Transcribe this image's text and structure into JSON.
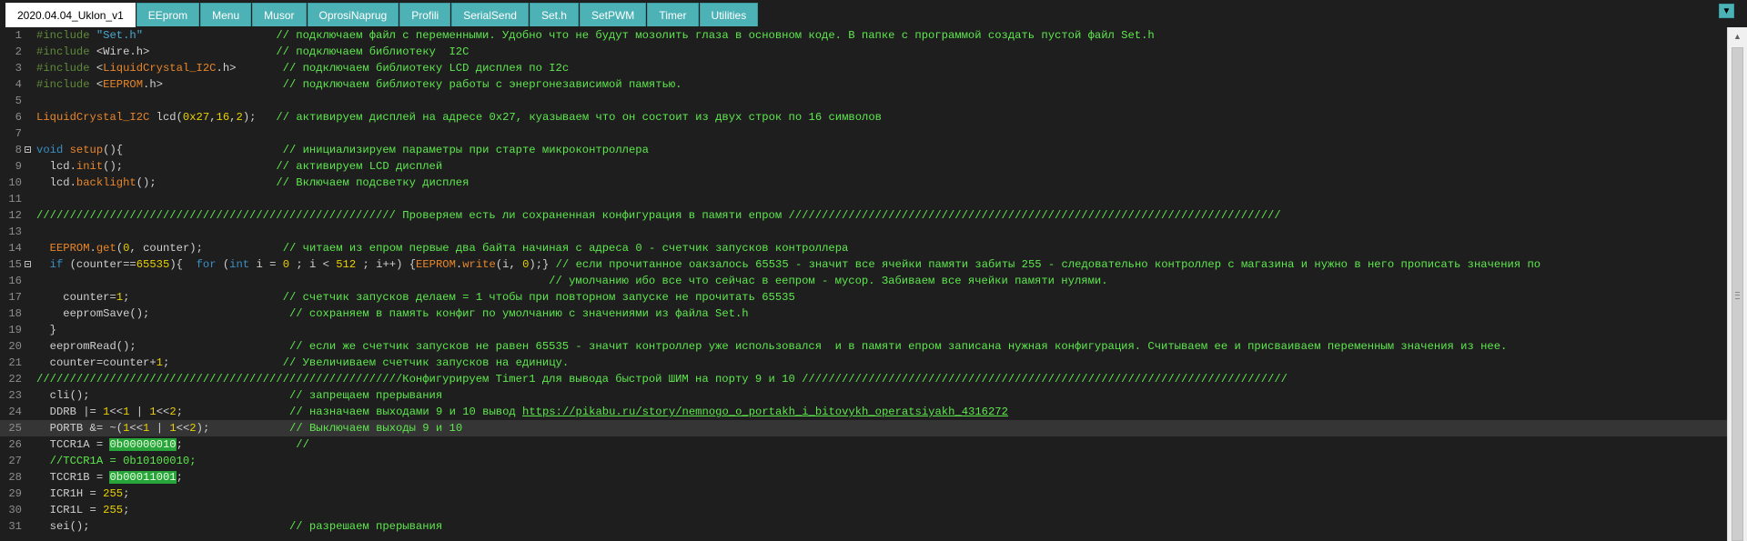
{
  "tabs": [
    {
      "label": "2020.04.04_Uklon_v1",
      "active": true
    },
    {
      "label": "EEprom"
    },
    {
      "label": "Menu"
    },
    {
      "label": "Musor"
    },
    {
      "label": "OprosiNaprug"
    },
    {
      "label": "Profili"
    },
    {
      "label": "SerialSend"
    },
    {
      "label": "Set.h"
    },
    {
      "label": "SetPWM"
    },
    {
      "label": "Timer"
    },
    {
      "label": "Utilities"
    }
  ],
  "tab_menu_icon": "▼",
  "scrollbar_up_icon": "▲",
  "current_line": 25,
  "colors": {
    "tab_bg": "#4db2b6",
    "editor_bg": "#1e1e1e",
    "comment": "#5ee84e",
    "keyword": "#3a8fc4",
    "number": "#e8d000",
    "class": "#e8862a"
  },
  "lines": [
    {
      "n": "1",
      "tokens": [
        {
          "t": "#include ",
          "c": "prep"
        },
        {
          "t": "\"Set.h\"",
          "c": "str"
        },
        {
          "t": "                    "
        },
        {
          "t": "// подключаем файл с переменными. Удобно что не будут мозолить глаза в основном коде. В папке с программой создать пустой файл Set.h",
          "c": "cmt"
        }
      ]
    },
    {
      "n": "2",
      "tokens": [
        {
          "t": "#include ",
          "c": "prep"
        },
        {
          "t": "<Wire.h>"
        },
        {
          "t": "                   "
        },
        {
          "t": "// подключаем библиотеку  I2C",
          "c": "cmt"
        }
      ]
    },
    {
      "n": "3",
      "tokens": [
        {
          "t": "#include ",
          "c": "prep"
        },
        {
          "t": "<"
        },
        {
          "t": "LiquidCrystal_I2C",
          "c": "lib"
        },
        {
          "t": ".h>"
        },
        {
          "t": "       "
        },
        {
          "t": "// подключаем библиотеку LCD дисплея по I2c",
          "c": "cmt"
        }
      ]
    },
    {
      "n": "4",
      "tokens": [
        {
          "t": "#include ",
          "c": "prep"
        },
        {
          "t": "<"
        },
        {
          "t": "EEPROM",
          "c": "lib"
        },
        {
          "t": ".h>"
        },
        {
          "t": "                  "
        },
        {
          "t": "// подключаем библиотеку работы с энергонезависимой памятью.",
          "c": "cmt"
        }
      ]
    },
    {
      "n": "5",
      "tokens": []
    },
    {
      "n": "6",
      "tokens": [
        {
          "t": "LiquidCrystal_I2C",
          "c": "cls"
        },
        {
          "t": " lcd("
        },
        {
          "t": "0x27",
          "c": "num"
        },
        {
          "t": ","
        },
        {
          "t": "16",
          "c": "num"
        },
        {
          "t": ","
        },
        {
          "t": "2",
          "c": "num"
        },
        {
          "t": ");"
        },
        {
          "t": "   "
        },
        {
          "t": "// активируем дисплей на адресе 0x27, куазываем что он состоит из двух строк по 16 символов",
          "c": "cmt"
        }
      ]
    },
    {
      "n": "7",
      "tokens": []
    },
    {
      "n": "8",
      "fold": true,
      "tokens": [
        {
          "t": "void",
          "c": "kw"
        },
        {
          "t": " "
        },
        {
          "t": "setup",
          "c": "cls"
        },
        {
          "t": "(){"
        },
        {
          "t": "                        "
        },
        {
          "t": "// инициализируем параметры при старте микроконтроллера",
          "c": "cmt"
        }
      ]
    },
    {
      "n": "9",
      "tokens": [
        {
          "t": "  lcd."
        },
        {
          "t": "init",
          "c": "cls"
        },
        {
          "t": "();"
        },
        {
          "t": "                       "
        },
        {
          "t": "// активируем LCD дисплей",
          "c": "cmt"
        }
      ]
    },
    {
      "n": "10",
      "tokens": [
        {
          "t": "  lcd."
        },
        {
          "t": "backlight",
          "c": "cls"
        },
        {
          "t": "();"
        },
        {
          "t": "                  "
        },
        {
          "t": "// Включаем подсветку дисплея",
          "c": "cmt"
        }
      ]
    },
    {
      "n": "11",
      "tokens": []
    },
    {
      "n": "12",
      "tokens": [
        {
          "t": "////////////////////////////////////////////////////// Проверяем есть ли сохраненная конфигурация в памяти епром //////////////////////////////////////////////////////////////////////////",
          "c": "cmt"
        }
      ]
    },
    {
      "n": "13",
      "tokens": []
    },
    {
      "n": "14",
      "tokens": [
        {
          "t": "  "
        },
        {
          "t": "EEPROM",
          "c": "cls"
        },
        {
          "t": "."
        },
        {
          "t": "get",
          "c": "cls"
        },
        {
          "t": "("
        },
        {
          "t": "0",
          "c": "num"
        },
        {
          "t": ", counter);"
        },
        {
          "t": "            "
        },
        {
          "t": "// читаем из епром первые два байта начиная с адреса 0 - счетчик запусков контроллера",
          "c": "cmt"
        }
      ]
    },
    {
      "n": "15",
      "fold": true,
      "tokens": [
        {
          "t": "  "
        },
        {
          "t": "if",
          "c": "kw"
        },
        {
          "t": " (counter=="
        },
        {
          "t": "65535",
          "c": "num"
        },
        {
          "t": "){  "
        },
        {
          "t": "for",
          "c": "kw"
        },
        {
          "t": " ("
        },
        {
          "t": "int",
          "c": "kw"
        },
        {
          "t": " i = "
        },
        {
          "t": "0",
          "c": "num"
        },
        {
          "t": " ; i < "
        },
        {
          "t": "512",
          "c": "num"
        },
        {
          "t": " ; i++) {"
        },
        {
          "t": "EEPROM",
          "c": "cls"
        },
        {
          "t": "."
        },
        {
          "t": "write",
          "c": "cls"
        },
        {
          "t": "(i, "
        },
        {
          "t": "0",
          "c": "num"
        },
        {
          "t": ");} "
        },
        {
          "t": "// если прочитанное оакзалось 65535 - значит все ячейки памяти забиты 255 - следовательно контроллер с магазина и нужно в него прописать значения по",
          "c": "cmt"
        }
      ]
    },
    {
      "n": "16",
      "tokens": [
        {
          "t": "                                                                             "
        },
        {
          "t": "// умолчанию ибо все что сейчас в еепром - мусор. Забиваем все ячейки памяти нулями.",
          "c": "cmt"
        }
      ]
    },
    {
      "n": "17",
      "tokens": [
        {
          "t": "    counter="
        },
        {
          "t": "1",
          "c": "num"
        },
        {
          "t": ";"
        },
        {
          "t": "                       "
        },
        {
          "t": "// счетчик запусков делаем = 1 чтобы при повторном запуске не прочитать 65535",
          "c": "cmt"
        }
      ]
    },
    {
      "n": "18",
      "tokens": [
        {
          "t": "    eepromSave();"
        },
        {
          "t": "                     "
        },
        {
          "t": "// сохраняем в память конфиг по умолчанию с значениями из файла Set.h",
          "c": "cmt"
        }
      ]
    },
    {
      "n": "19",
      "tokens": [
        {
          "t": "  }"
        }
      ]
    },
    {
      "n": "20",
      "tokens": [
        {
          "t": "  eepromRead();"
        },
        {
          "t": "                       "
        },
        {
          "t": "// если же счетчик запусков не равен 65535 - значит контроллер уже использовался  и в памяти епром записана нужная конфигурация. Считываем ее и присваиваем переменным значения из нее.",
          "c": "cmt"
        }
      ]
    },
    {
      "n": "21",
      "tokens": [
        {
          "t": "  counter=counter+"
        },
        {
          "t": "1",
          "c": "num"
        },
        {
          "t": ";"
        },
        {
          "t": "                 "
        },
        {
          "t": "// Увеличиваем счетчик запусков на единицу.",
          "c": "cmt"
        }
      ]
    },
    {
      "n": "22",
      "tokens": [
        {
          "t": "///////////////////////////////////////////////////////Конфигурируем Timer1 для вывода быстрой ШИМ на порту 9 и 10 /////////////////////////////////////////////////////////////////////////",
          "c": "cmt"
        }
      ]
    },
    {
      "n": "23",
      "tokens": [
        {
          "t": "  cli();"
        },
        {
          "t": "                              "
        },
        {
          "t": "// запрещаем прерывания",
          "c": "cmt"
        }
      ]
    },
    {
      "n": "24",
      "tokens": [
        {
          "t": "  DDRB |= "
        },
        {
          "t": "1",
          "c": "num"
        },
        {
          "t": "<<"
        },
        {
          "t": "1",
          "c": "num"
        },
        {
          "t": " | "
        },
        {
          "t": "1",
          "c": "num"
        },
        {
          "t": "<<"
        },
        {
          "t": "2",
          "c": "num"
        },
        {
          "t": ";"
        },
        {
          "t": "                "
        },
        {
          "t": "// назначаем выходами 9 и 10 вывод ",
          "c": "cmt"
        },
        {
          "t": "https://pikabu.ru/story/nemnogo_o_portakh_i_bitovykh_operatsiyakh_4316272",
          "c": "url"
        }
      ]
    },
    {
      "n": "25",
      "tokens": [
        {
          "t": "  PORTB &= ~("
        },
        {
          "t": "1",
          "c": "num"
        },
        {
          "t": "<<"
        },
        {
          "t": "1",
          "c": "num"
        },
        {
          "t": " | "
        },
        {
          "t": "1",
          "c": "num"
        },
        {
          "t": "<<"
        },
        {
          "t": "2",
          "c": "num"
        },
        {
          "t": ");"
        },
        {
          "t": "            "
        },
        {
          "t": "// Выключаем выходы 9 и 10",
          "c": "cmt"
        }
      ]
    },
    {
      "n": "26",
      "tokens": [
        {
          "t": "  TCCR1A = "
        },
        {
          "t": "0b00000010",
          "c": "hl"
        },
        {
          "t": ";"
        },
        {
          "t": "                 "
        },
        {
          "t": "//",
          "c": "cmt"
        }
      ]
    },
    {
      "n": "27",
      "tokens": [
        {
          "t": "  //TCCR1A = 0b10100010;",
          "c": "cmt"
        }
      ]
    },
    {
      "n": "28",
      "tokens": [
        {
          "t": "  TCCR1B = "
        },
        {
          "t": "0b00011001",
          "c": "hl"
        },
        {
          "t": ";"
        }
      ]
    },
    {
      "n": "29",
      "tokens": [
        {
          "t": "  ICR1H = "
        },
        {
          "t": "255",
          "c": "num"
        },
        {
          "t": ";"
        }
      ]
    },
    {
      "n": "30",
      "tokens": [
        {
          "t": "  ICR1L = "
        },
        {
          "t": "255",
          "c": "num"
        },
        {
          "t": ";"
        }
      ]
    },
    {
      "n": "31",
      "tokens": [
        {
          "t": "  sei();"
        },
        {
          "t": "                              "
        },
        {
          "t": "// разрешаем прерывания",
          "c": "cmt"
        }
      ]
    }
  ]
}
